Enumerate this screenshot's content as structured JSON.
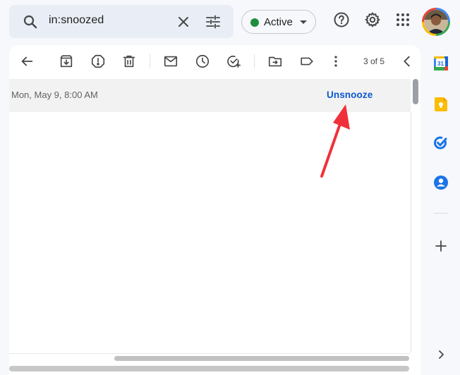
{
  "search": {
    "value": "in:snoozed"
  },
  "status": {
    "label": "Active",
    "color": "#1e8e3e"
  },
  "toolbar": {
    "pager": "3 of 5"
  },
  "message": {
    "snooze_date": "Mon, May 9, 8:00 AM",
    "unsnooze_label": "Unsnooze"
  },
  "side_panel": {
    "calendar_day": "31"
  },
  "annotation": {
    "arrow_color": "#f0313a"
  }
}
